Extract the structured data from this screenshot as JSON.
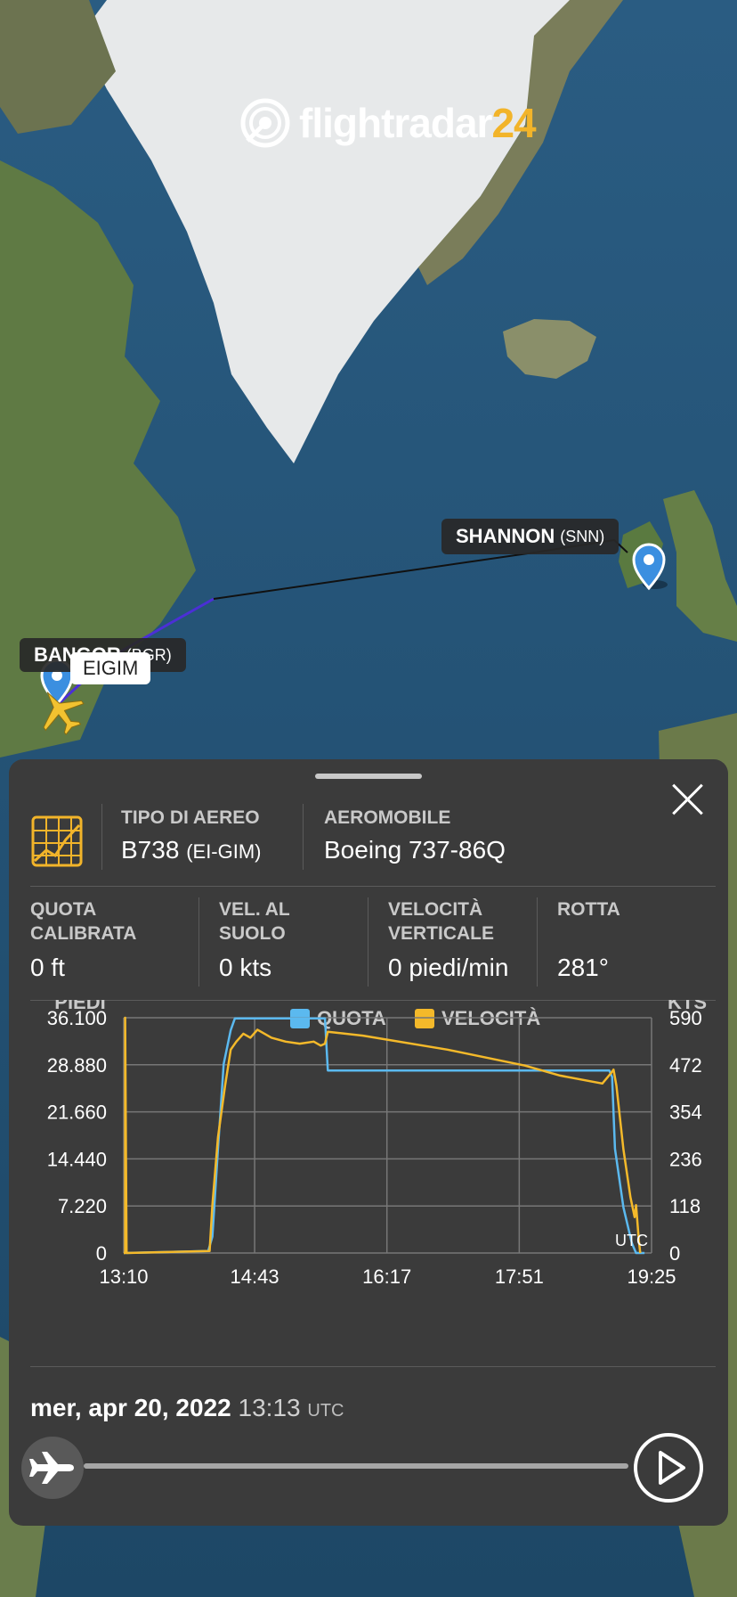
{
  "brand": {
    "name": "flightradar",
    "name_suffix": "24",
    "accent": "#f2b42a"
  },
  "map": {
    "airports": [
      {
        "name": "SHANNON",
        "code": "(SNN)"
      },
      {
        "name": "BANGOR",
        "code": "(BGR)"
      }
    ],
    "aircraft_label": "EIGIM",
    "route_color": "#4b2fd6",
    "pin_color": "#3b8fe0",
    "plane_color": "#f2c230"
  },
  "panel": {
    "aircraft_type_label": "TIPO DI AEREO",
    "aircraft_type_value": "B738",
    "aircraft_type_reg": "(EI-GIM)",
    "aircraft_label": "AEROMOBILE",
    "aircraft_value": "Boeing 737-86Q",
    "stats": [
      {
        "label": "QUOTA CALIBRATA",
        "value": "0 ft"
      },
      {
        "label": "VEL. AL SUOLO",
        "value": "0 kts"
      },
      {
        "label": "VELOCITÀ VERTICALE",
        "value": "0 piedi/min"
      },
      {
        "label": "ROTTA",
        "value": "281°"
      }
    ],
    "date": "mer, apr 20, 2022",
    "time": "13:13",
    "tz": "UTC",
    "playback_progress": 0.02
  },
  "chart_data": {
    "type": "line",
    "left_axis_label": "PIEDI",
    "right_axis_label": "KTS",
    "utc_label": "UTC",
    "legend": [
      {
        "name": "QUOTA",
        "color": "#5bb9ef"
      },
      {
        "name": "VELOCITÀ",
        "color": "#f4b92a"
      }
    ],
    "x_ticks": [
      "13:10",
      "14:43",
      "16:17",
      "17:51",
      "19:25"
    ],
    "y_left_ticks": [
      "36.100",
      "28.880",
      "21.660",
      "14.440",
      "7.220",
      "0"
    ],
    "y_right_ticks": [
      "590",
      "472",
      "354",
      "236",
      "118",
      "0"
    ],
    "x_range": [
      "13:10",
      "19:25"
    ],
    "y_left_range": [
      0,
      36100
    ],
    "y_right_range": [
      0,
      590
    ],
    "series": [
      {
        "name": "QUOTA",
        "axis": "left",
        "x": [
          "13:10",
          "14:10",
          "14:13",
          "14:17",
          "14:21",
          "14:26",
          "14:29",
          "15:33",
          "15:35",
          "18:55",
          "18:57",
          "18:59",
          "19:05",
          "19:11",
          "19:14",
          "19:17",
          "19:20"
        ],
        "y": [
          0,
          300,
          2500,
          16000,
          29000,
          34200,
          36000,
          36000,
          28000,
          28000,
          27000,
          16000,
          7000,
          1500,
          0,
          0,
          0
        ]
      },
      {
        "name": "VELOCITÀ",
        "axis": "right",
        "x": [
          "13:10",
          "13:11",
          "13:11",
          "13:12",
          "14:11",
          "14:13",
          "14:17",
          "14:22",
          "14:26",
          "14:30",
          "14:35",
          "14:40",
          "14:45",
          "14:55",
          "15:05",
          "15:15",
          "15:25",
          "15:30",
          "15:33",
          "15:35",
          "16:00",
          "17:00",
          "17:55",
          "18:20",
          "18:50",
          "18:56",
          "18:58",
          "19:00",
          "19:05",
          "19:10",
          "19:13",
          "19:14",
          "19:16",
          "19:17"
        ],
        "y": [
          0,
          0,
          590,
          0,
          5,
          120,
          290,
          420,
          510,
          530,
          550,
          540,
          560,
          540,
          530,
          525,
          530,
          520,
          525,
          555,
          545,
          510,
          470,
          445,
          425,
          450,
          460,
          420,
          260,
          140,
          90,
          120,
          30,
          0
        ]
      }
    ]
  }
}
